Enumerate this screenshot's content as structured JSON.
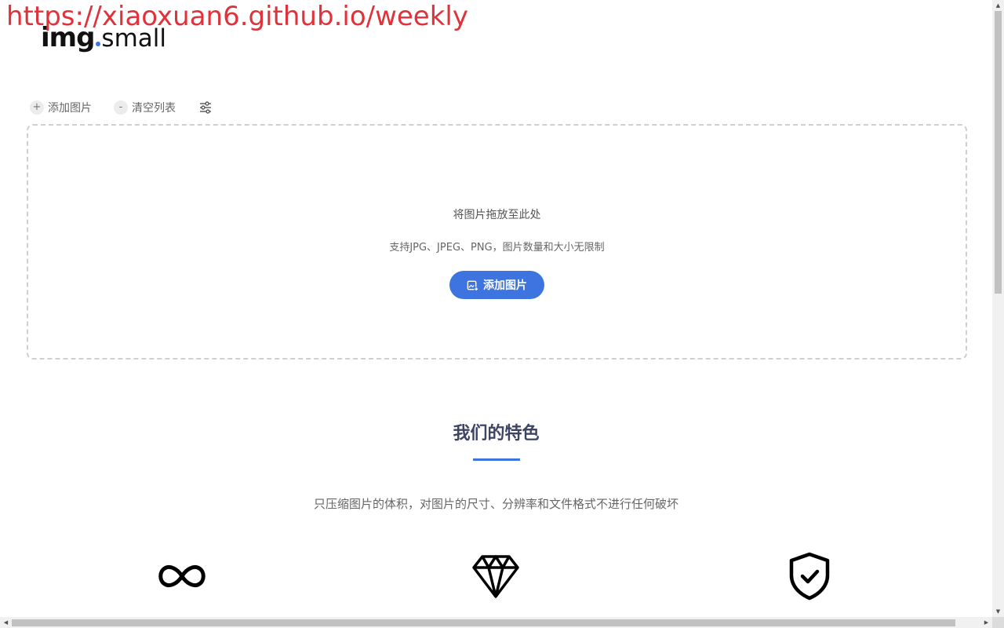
{
  "watermark": {
    "text": "https://xiaoxuan6.github.io/weekly"
  },
  "logo": {
    "part1": "img",
    "part2": "small",
    "accent_color": "#3d74e0"
  },
  "toolbar": {
    "add_icon": "+",
    "add_label": "添加图片",
    "clear_icon": "-",
    "clear_label": "清空列表",
    "settings_icon": "sliders-icon"
  },
  "dropzone": {
    "title": "将图片拖放至此处",
    "subtitle": "支持JPG、JPEG、PNG，图片数量和大小无限制",
    "button_label": "添加图片",
    "button_icon": "image-add-icon",
    "button_color": "#3d74e0"
  },
  "features": {
    "title": "我们的特色",
    "description": "只压缩图片的体积，对图片的尺寸、分辨率和文件格式不进行任何破坏",
    "icons": [
      "infinity-icon",
      "diamond-icon",
      "shield-check-icon"
    ]
  }
}
